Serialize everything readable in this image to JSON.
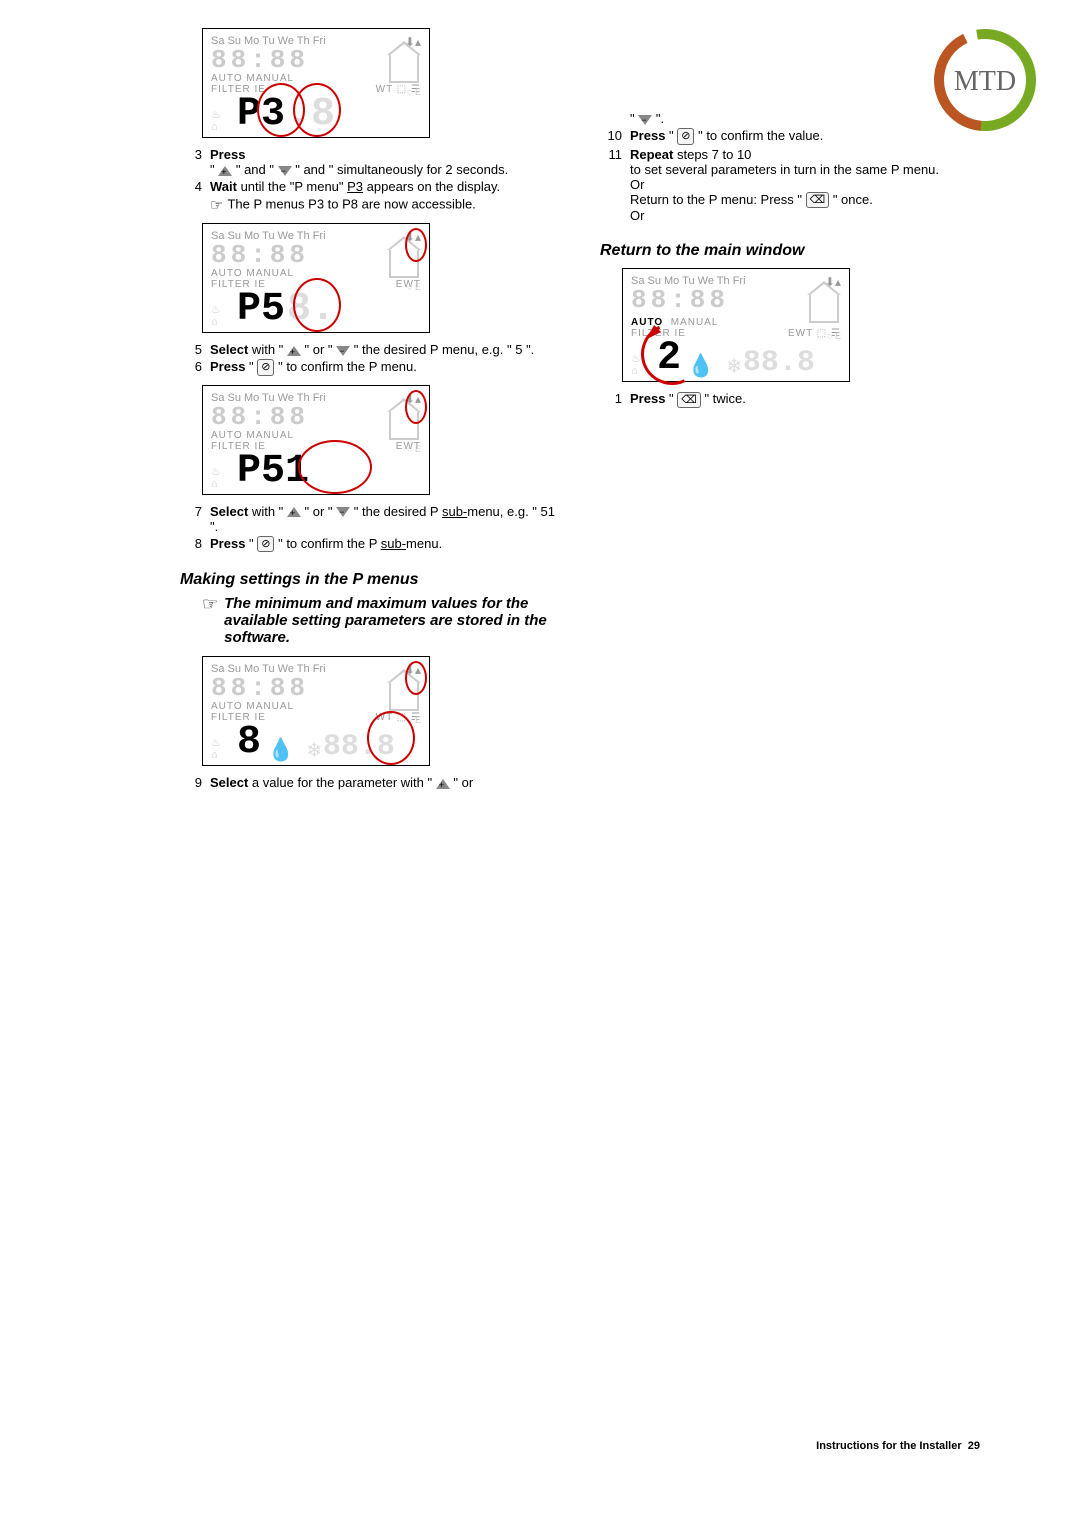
{
  "logo_text": "MTD",
  "lcd": {
    "days": "Sa Su Mo Tu We Th Fri",
    "time": "88:88",
    "modes": "AUTO  MANUAL",
    "filter": "FILTER IE",
    "ewt": "EWT"
  },
  "displays": {
    "d1_main": "P3",
    "d1_ghost": ".8",
    "d2_main": "P5",
    "d2_ghost": "8.",
    "d3_main": "P51",
    "d4_main": "8",
    "d4_ghost": "88.8",
    "d4_circ": "1",
    "d5_main": "2",
    "d5_ghost": "88.8"
  },
  "left": {
    "s3": {
      "n": "3",
      "b": "Press",
      "t": " \" and \" simultaneously for 2 seconds.",
      "mid": " \""
    },
    "s4": {
      "n": "4",
      "b": "Wait",
      "t1": " until the \"P menu\" ",
      "u": "P3",
      "t2": " appears on the display."
    },
    "note1": "The P menus P3 to P8 are now accessible.",
    "s5": {
      "n": "5",
      "b": "Select",
      "t1": " with \" ",
      "t2": " \" or \" ",
      "t3": " \" the desired P menu, e.g. \" 5 \"."
    },
    "s6": {
      "n": "6",
      "b": "Press",
      "t1": " \" ",
      "t2": " \" to confirm the P menu."
    },
    "s7": {
      "n": "7",
      "b": "Select",
      "t1": " with \" ",
      "t2": " \" or \" ",
      "t3": " \" the desired P ",
      "u": "sub-",
      "t4": "menu, e.g. \" 51 \"."
    },
    "s8": {
      "n": "8",
      "b": "Press",
      "t1": " \" ",
      "t2": " \" to confirm the P ",
      "u": "sub-",
      "t3": "menu."
    },
    "h_settings": "Making settings in the P menus",
    "hint": "The minimum and maximum values for the available setting parameters are stored in the software.",
    "s9": {
      "n": "9",
      "b": "Select",
      "t1": " a value for the parameter with \" ",
      "t2": " \" or"
    }
  },
  "right": {
    "cont": " \".",
    "s10": {
      "n": "10",
      "b": "Press",
      "t1": " \" ",
      "t2": " \" to confirm the value."
    },
    "s11": {
      "n": "11",
      "b": "Repeat",
      "t1": " steps 7 to 10",
      "t2": "to set several parameters in turn in the same P menu.",
      "or": "Or",
      "t3": "Return to the P menu: Press \" ",
      "t4": " \" once.",
      "or2": "Or"
    },
    "h_return": "Return to the main window",
    "s1": {
      "n": "1",
      "b": "Press",
      "t1": " \" ",
      "t2": " \" twice."
    }
  },
  "footer": {
    "label": "Instructions for the Installer",
    "page": "29"
  }
}
